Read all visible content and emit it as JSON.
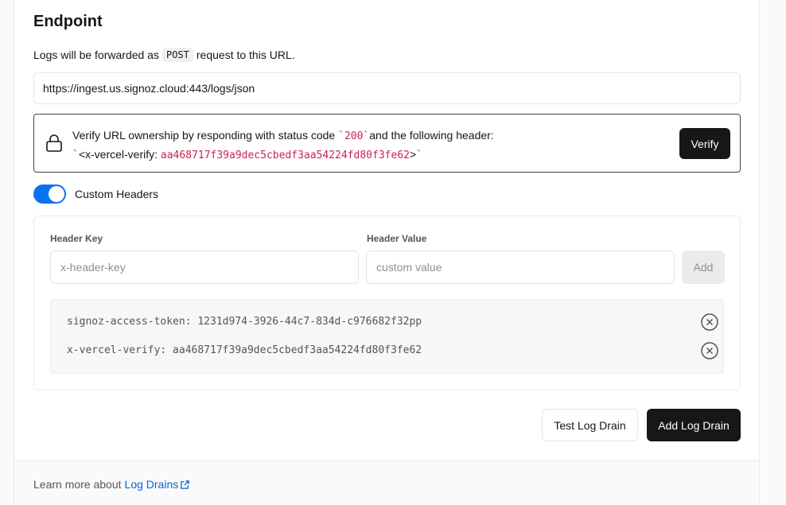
{
  "endpoint": {
    "title": "Endpoint",
    "desc_before": "Logs will be forwarded as",
    "method": "POST",
    "desc_after": "request to this URL.",
    "url_value": "https://ingest.us.signoz.cloud:443/logs/json"
  },
  "verify": {
    "text_before": "Verify URL ownership by responding with status code",
    "tick": "`",
    "status_code": "200",
    "text_after": "and the following header:",
    "header_prefix": "<x-vercel-verify:",
    "header_value": "aa468717f39a9dec5cbedf3aa54224fd80f3fe62",
    "header_suffix": ">",
    "button_label": "Verify"
  },
  "custom_headers": {
    "label": "Custom Headers",
    "enabled": true,
    "key_label": "Header Key",
    "key_placeholder": "x-header-key",
    "value_label": "Header Value",
    "value_placeholder": "custom value",
    "add_label": "Add",
    "items": [
      "signoz-access-token: 1231d974-3926-44c7-834d-c976682f32pp",
      "x-vercel-verify: aa468717f39a9dec5cbedf3aa54224fd80f3fe62"
    ]
  },
  "actions": {
    "test_label": "Test Log Drain",
    "add_label": "Add Log Drain"
  },
  "footer": {
    "text": "Learn more about",
    "link": "Log Drains"
  },
  "colors": {
    "accent": "#0a72ef",
    "link": "#0068d6",
    "code_red": "#c7254e",
    "dark_button": "#171717"
  }
}
